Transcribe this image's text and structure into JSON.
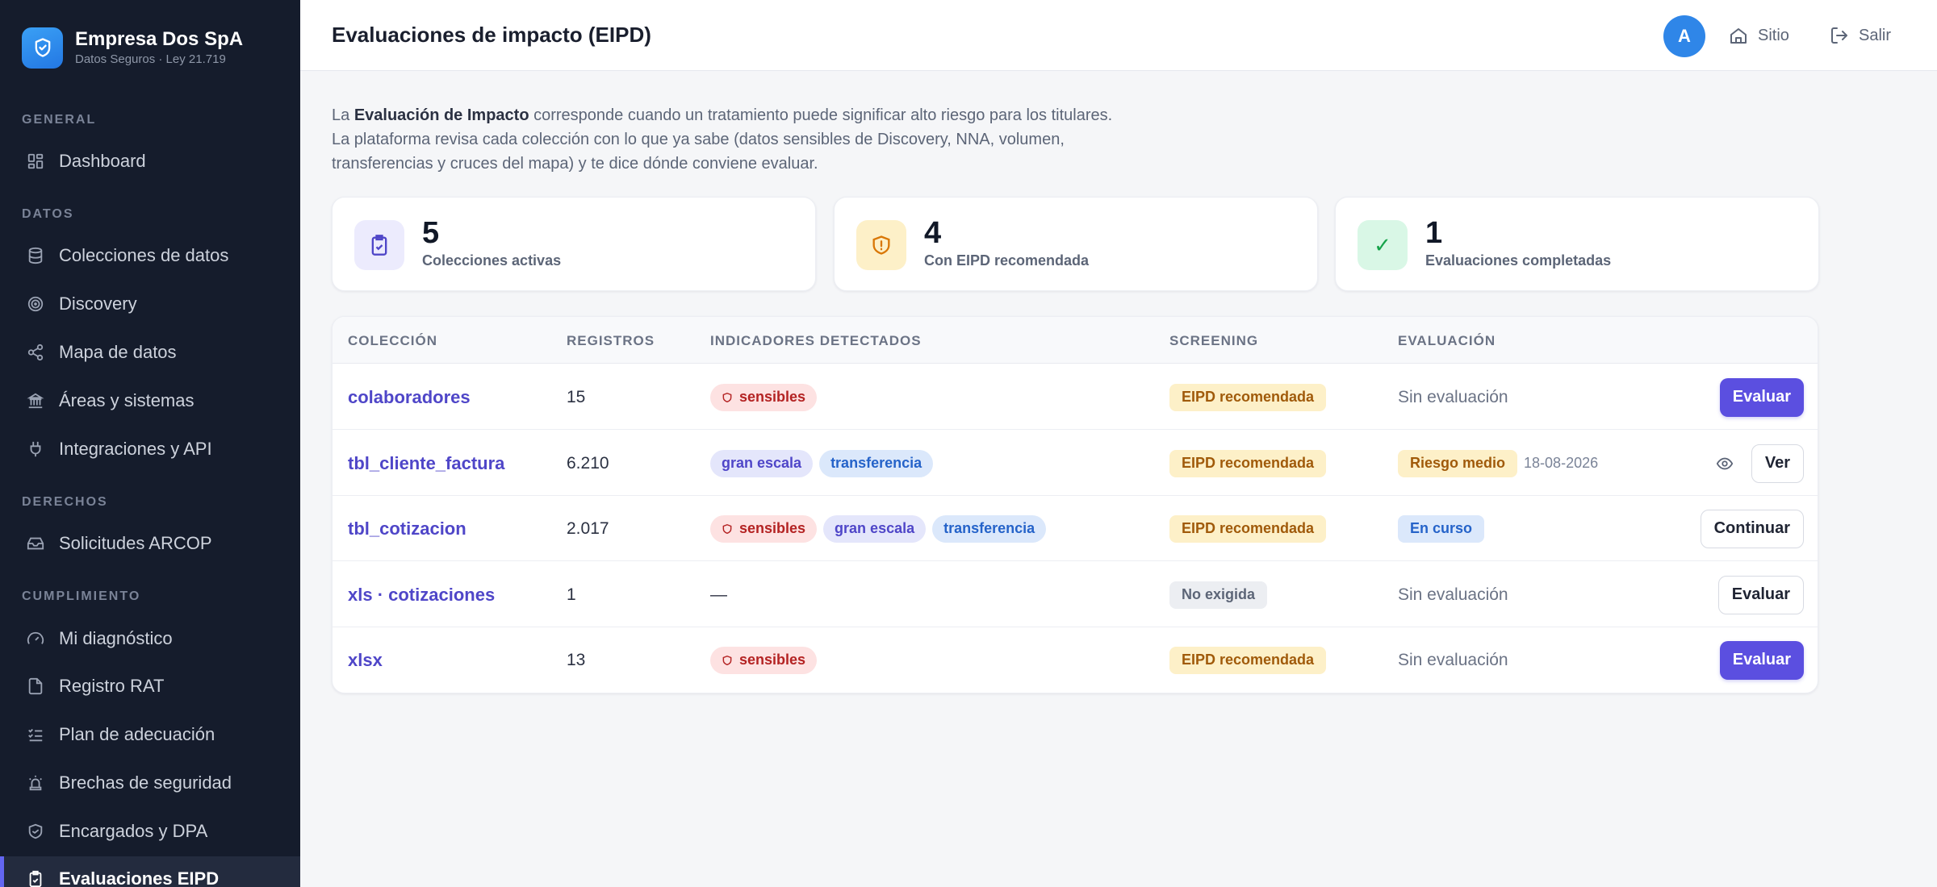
{
  "brand": {
    "name": "Empresa Dos SpA",
    "subtitle": "Datos Seguros · Ley 21.719"
  },
  "sidebar": {
    "sections": [
      {
        "label": "GENERAL"
      },
      {
        "label": "DATOS"
      },
      {
        "label": "DERECHOS"
      },
      {
        "label": "CUMPLIMIENTO"
      }
    ],
    "items": [
      {
        "label": "Dashboard",
        "icon": "grid-icon"
      },
      {
        "label": "Colecciones de datos",
        "icon": "database-icon"
      },
      {
        "label": "Discovery",
        "icon": "radar-icon"
      },
      {
        "label": "Mapa de datos",
        "icon": "share-icon"
      },
      {
        "label": "Áreas y sistemas",
        "icon": "building-icon"
      },
      {
        "label": "Integraciones y API",
        "icon": "plug-icon"
      },
      {
        "label": "Solicitudes ARCOP",
        "icon": "inbox-icon"
      },
      {
        "label": "Mi diagnóstico",
        "icon": "gauge-icon"
      },
      {
        "label": "Registro RAT",
        "icon": "file-icon"
      },
      {
        "label": "Plan de adecuación",
        "icon": "checklist-icon"
      },
      {
        "label": "Brechas de seguridad",
        "icon": "siren-icon"
      },
      {
        "label": "Encargados y DPA",
        "icon": "handshake-shield-icon"
      },
      {
        "label": "Evaluaciones EIPD",
        "icon": "clipboard-check-icon",
        "active": true
      }
    ]
  },
  "header": {
    "title": "Evaluaciones de impacto (EIPD)",
    "avatar_initial": "A",
    "site_label": "Sitio",
    "logout_label": "Salir"
  },
  "intro": {
    "prefix": "La ",
    "bold": "Evaluación de Impacto",
    "suffix": " corresponde cuando un tratamiento puede significar alto riesgo para los titulares.",
    "line2": "La plataforma revisa cada colección con lo que ya sabe (datos sensibles de Discovery, NNA, volumen,",
    "line3": "transferencias y cruces del mapa) y te dice dónde conviene evaluar."
  },
  "stats": [
    {
      "value": "5",
      "label": "Colecciones activas",
      "icon": "clipboard-check-icon",
      "color": "#4f46c8"
    },
    {
      "value": "4",
      "label": "Con EIPD recomendada",
      "icon": "shield-alert-icon",
      "color": "#d97706"
    },
    {
      "value": "1",
      "label": "Evaluaciones completadas",
      "icon": "check-icon",
      "color": "#16a34a"
    }
  ],
  "table": {
    "headers": [
      "COLECCIÓN",
      "REGISTROS",
      "INDICADORES DETECTADOS",
      "SCREENING",
      "EVALUACIÓN"
    ],
    "rows": [
      {
        "collection": "colaboradores",
        "records": "15",
        "indicators": [
          "sensibles"
        ],
        "screening": "EIPD recomendada",
        "evaluation": "Sin evaluación",
        "action": "Evaluar"
      },
      {
        "collection": "tbl_cliente_factura",
        "records": "6.210",
        "indicators": [
          "gran escala",
          "transferencia"
        ],
        "screening": "EIPD recomendada",
        "evaluation_badge": "Riesgo medio",
        "evaluation_date": "18-08-2026",
        "action": "Ver"
      },
      {
        "collection": "tbl_cotizacion",
        "records": "2.017",
        "indicators": [
          "sensibles",
          "gran escala",
          "transferencia"
        ],
        "screening": "EIPD recomendada",
        "evaluation_badge": "En curso",
        "action": "Continuar"
      },
      {
        "collection": "xls · cotizaciones",
        "records": "1",
        "indicators_empty": "—",
        "screening": "No exigida",
        "evaluation": "Sin evaluación",
        "action": "Evaluar"
      },
      {
        "collection": "xlsx",
        "records": "13",
        "indicators": [
          "sensibles"
        ],
        "screening": "EIPD recomendada",
        "evaluation": "Sin evaluación",
        "action": "Evaluar"
      }
    ]
  }
}
